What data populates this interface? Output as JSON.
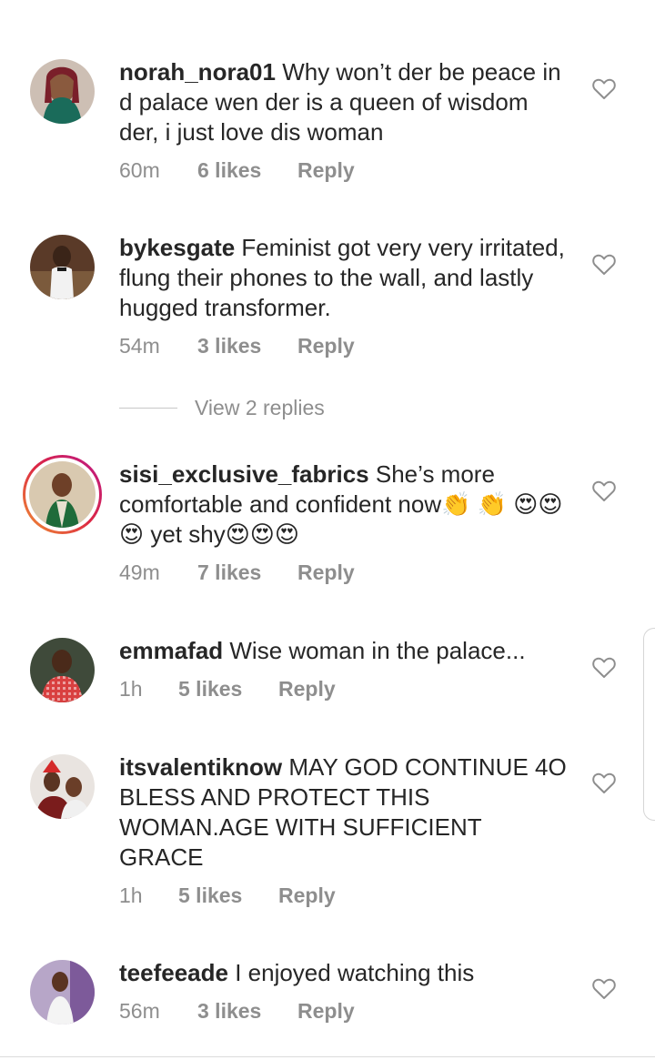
{
  "comments": [
    {
      "username": "norah_nora01",
      "text": "Why won’t der be peace in d palace wen der is a queen of wisdom der, i just love dis woman",
      "time": "60m",
      "likes": "6 likes",
      "reply": "Reply"
    },
    {
      "username": "bykesgate",
      "text": "Feminist got very very irritated, flung their phones to the wall, and  lastly hugged transformer.",
      "time": "54m",
      "likes": "3 likes",
      "reply": "Reply"
    },
    {
      "username": "sisi_exclusive_fabrics",
      "text": "She’s more comfortable and confident now👏 👏 😍😍😍 yet shy😍😍😍",
      "time": "49m",
      "likes": "7 likes",
      "reply": "Reply"
    },
    {
      "username": "emmafad",
      "text": "Wise woman in the palace...",
      "time": "1h",
      "likes": "5 likes",
      "reply": "Reply"
    },
    {
      "username": "itsvalentiknow",
      "text": "MAY GOD CONTINUE 4O BLESS AND PROTECT THIS WOMAN.AGE WITH SUFFICIENT GRACE",
      "time": "1h",
      "likes": "5 likes",
      "reply": "Reply"
    },
    {
      "username": "teefeeade",
      "text": "I enjoyed watching this",
      "time": "56m",
      "likes": "3 likes",
      "reply": "Reply"
    }
  ],
  "view_replies": "View 2 replies",
  "icons": {
    "like": "heart-outline-icon"
  },
  "colors": {
    "text": "#262626",
    "muted": "#8e8e8e",
    "story_ring": "#dc2743"
  }
}
